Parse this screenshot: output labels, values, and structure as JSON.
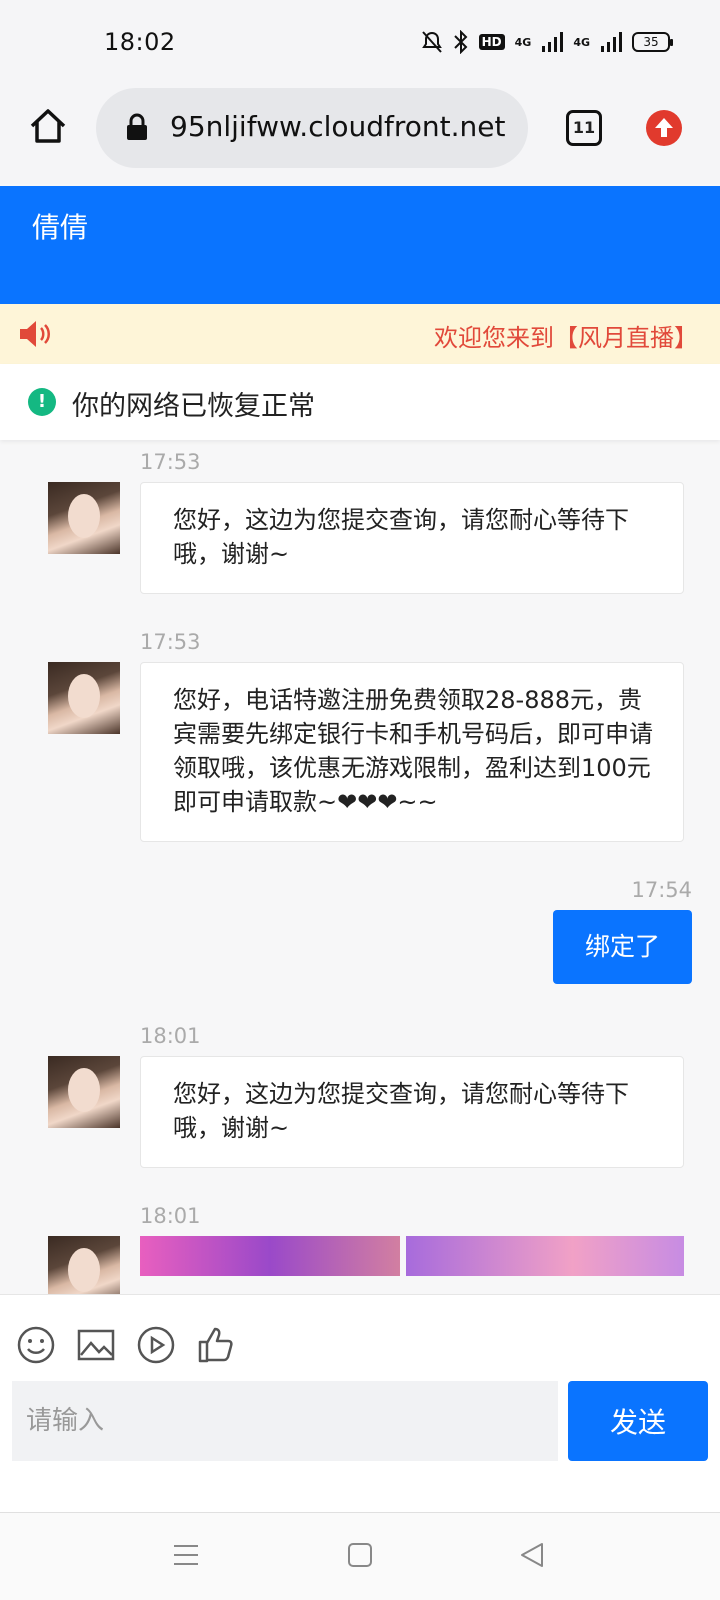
{
  "status_bar": {
    "time": "18:02",
    "network_1": "4G",
    "network_2": "4G",
    "hd_label": "HD",
    "battery": "35"
  },
  "browser": {
    "url": "95nljifww.cloudfront.net",
    "tab_count": "11",
    "icons": {
      "home": "home-icon",
      "lock": "lock-icon",
      "tabs": "tabs-icon",
      "upload": "upload-icon"
    },
    "accent_red": "#e13a2d"
  },
  "chat": {
    "title": "倩倩",
    "header_color": "#0a74ff",
    "notice": "欢迎您来到【风月直播】",
    "network_status": "你的网络已恢复正常",
    "messages": [
      {
        "side": "left",
        "time": "17:53",
        "text": "您好，这边为您提交查询，请您耐心等待下哦，谢谢~"
      },
      {
        "side": "left",
        "time": "17:53",
        "text": "您好，电话特邀注册免费领取28-888元，贵宾需要先绑定银行卡和手机号码后，即可申请领取哦，该优惠无游戏限制，盈利达到100元即可申请取款~❤❤❤~~"
      },
      {
        "side": "right",
        "time": "17:54",
        "text": "绑定了"
      },
      {
        "side": "left",
        "time": "18:01",
        "text": "您好，这边为您提交查询，请您耐心等待下哦，谢谢~"
      },
      {
        "side": "left",
        "time": "18:01",
        "text": ""
      }
    ]
  },
  "input": {
    "placeholder": "请输入",
    "send_label": "发送",
    "tools": [
      "emoji-icon",
      "image-icon",
      "video-icon",
      "thumbs-up-icon"
    ]
  },
  "nav": {
    "buttons": [
      "menu-icon",
      "home-square-icon",
      "back-triangle-icon"
    ]
  }
}
